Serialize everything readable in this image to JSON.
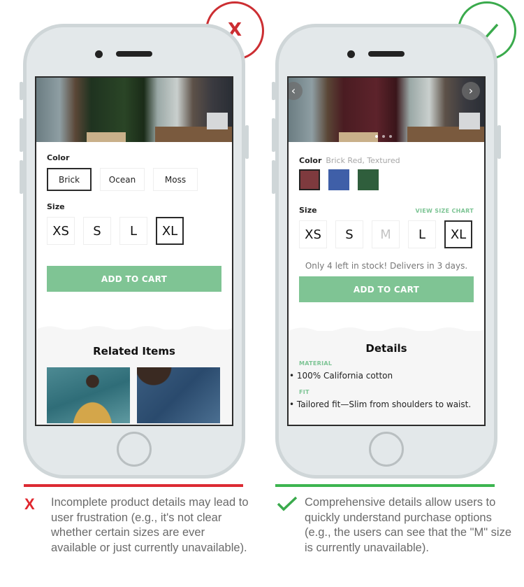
{
  "bad_example": {
    "badge_icon": "x-mark-icon",
    "badge_text": "X",
    "color_label": "Color",
    "color_options": [
      {
        "label": "Brick",
        "selected": true
      },
      {
        "label": "Ocean",
        "selected": false
      },
      {
        "label": "Moss",
        "selected": false
      }
    ],
    "size_label": "Size",
    "sizes": [
      {
        "label": "XS",
        "selected": false
      },
      {
        "label": "S",
        "selected": false
      },
      {
        "label": "L",
        "selected": false
      },
      {
        "label": "XL",
        "selected": true
      }
    ],
    "add_to_cart": "ADD TO CART",
    "related_title": "Related Items",
    "caption_icon_text": "X",
    "caption": "Incomplete product details may lead to user frustration (e.g., it's not clear whether certain sizes are ever available or just currently unavailable)."
  },
  "good_example": {
    "badge_icon": "checkmark-icon",
    "carousel": {
      "prev": "‹",
      "next": "›",
      "slides": 3,
      "active_slide": 1
    },
    "color_label": "Color",
    "color_selected_name": "Brick Red, Textured",
    "swatches": [
      {
        "name": "brick-red",
        "color": "#7e3a3e",
        "selected": true
      },
      {
        "name": "ocean-blue",
        "color": "#3f5fa8",
        "selected": false
      },
      {
        "name": "moss-green",
        "color": "#2f5e3c",
        "selected": false
      }
    ],
    "size_label": "Size",
    "size_chart_link": "VIEW SIZE CHART",
    "sizes": [
      {
        "label": "XS",
        "selected": false,
        "available": true
      },
      {
        "label": "S",
        "selected": false,
        "available": true
      },
      {
        "label": "M",
        "selected": false,
        "available": false
      },
      {
        "label": "L",
        "selected": false,
        "available": true
      },
      {
        "label": "XL",
        "selected": true,
        "available": true
      }
    ],
    "stock_message": "Only 4 left in stock! Delivers in 3 days.",
    "add_to_cart": "ADD TO CART",
    "details_title": "Details",
    "details": [
      {
        "heading": "MATERIAL",
        "item": "• 100% California cotton"
      },
      {
        "heading": "FIT",
        "item": "• Tailored fit—Slim from shoulders to waist."
      }
    ],
    "caption": "Comprehensive details allow users to quickly understand purchase options (e.g., the users can see that the \"M\" size is currently unavailable)."
  },
  "colors": {
    "bad": "#dc2a33",
    "good": "#3db550",
    "cart_button": "#7fc494"
  }
}
